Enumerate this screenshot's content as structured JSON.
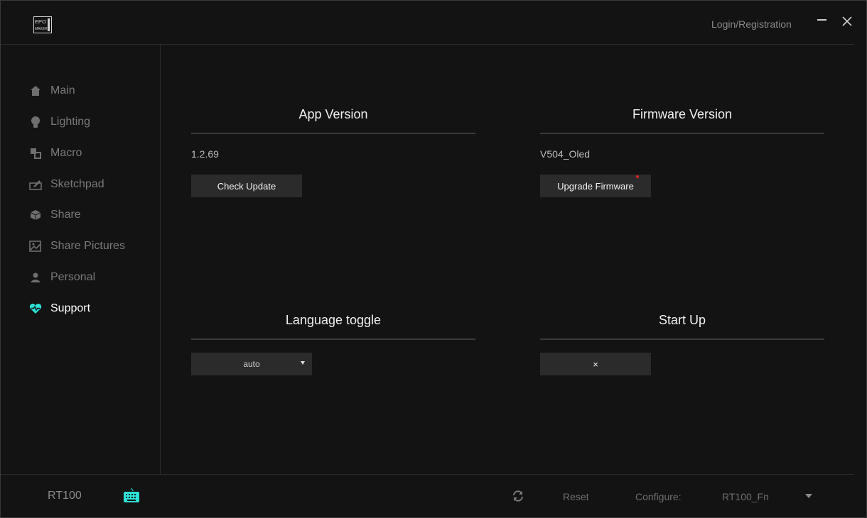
{
  "header": {
    "login_label": "Login/Registration"
  },
  "sidebar": {
    "items": [
      {
        "label": "Main",
        "icon": "home-icon"
      },
      {
        "label": "Lighting",
        "icon": "bulb-icon"
      },
      {
        "label": "Macro",
        "icon": "macro-icon"
      },
      {
        "label": "Sketchpad",
        "icon": "sketchpad-icon"
      },
      {
        "label": "Share",
        "icon": "cube-icon"
      },
      {
        "label": "Share Pictures",
        "icon": "picture-icon"
      },
      {
        "label": "Personal",
        "icon": "user-icon"
      },
      {
        "label": "Support",
        "icon": "heart-pulse-icon"
      }
    ],
    "active_index": 7,
    "accent_color": "#2de0d6"
  },
  "main": {
    "app_version": {
      "title": "App Version",
      "value": "1.2.69",
      "button_label": "Check Update"
    },
    "firmware_version": {
      "title": "Firmware Version",
      "value": "V504_Oled",
      "button_label": "Upgrade Firmware"
    },
    "language": {
      "title": "Language toggle",
      "selected": "auto"
    },
    "startup": {
      "title": "Start Up",
      "toggle_label": "×"
    }
  },
  "footer": {
    "model": "RT100",
    "reset_label": "Reset",
    "configure_label": "Configure:",
    "profile": "RT100_Fn"
  }
}
